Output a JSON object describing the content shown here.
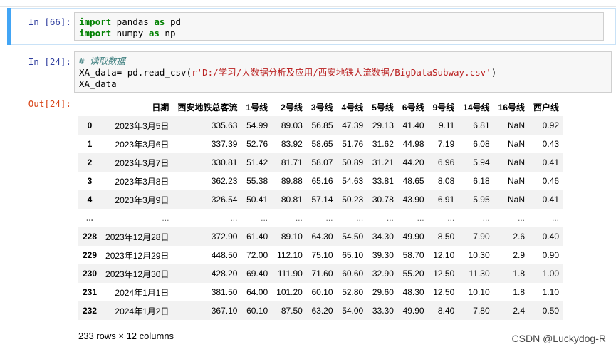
{
  "cell1": {
    "prompt": "In  [66]:",
    "lines": [
      {
        "kw1": "import",
        "mod": " pandas ",
        "kw2": "as",
        "alias": " pd"
      },
      {
        "kw1": "import",
        "mod": " numpy ",
        "kw2": "as",
        "alias": " np"
      }
    ]
  },
  "cell2": {
    "prompt": "In  [24]:",
    "comment": "# 读取数据",
    "line2_prefix": "XA_data= pd.read_csv(",
    "line2_string": "r'D:/学习/大数据分析及应用/西安地铁人流数据/BigDataSubway.csv'",
    "line2_suffix": ")",
    "line3": "XA_data"
  },
  "output": {
    "prompt": "Out[24]:",
    "columns": [
      "",
      "日期",
      "西安地铁总客流",
      "1号线",
      "2号线",
      "3号线",
      "4号线",
      "5号线",
      "6号线",
      "9号线",
      "14号线",
      "16号线",
      "西户线"
    ],
    "rows": [
      [
        "0",
        "2023年3月5日",
        "335.63",
        "54.99",
        "89.03",
        "56.85",
        "47.39",
        "29.13",
        "41.40",
        "9.11",
        "6.81",
        "NaN",
        "0.92"
      ],
      [
        "1",
        "2023年3月6日",
        "337.39",
        "52.76",
        "83.92",
        "58.65",
        "51.76",
        "31.62",
        "44.98",
        "7.19",
        "6.08",
        "NaN",
        "0.43"
      ],
      [
        "2",
        "2023年3月7日",
        "330.81",
        "51.42",
        "81.71",
        "58.07",
        "50.89",
        "31.21",
        "44.20",
        "6.96",
        "5.94",
        "NaN",
        "0.41"
      ],
      [
        "3",
        "2023年3月8日",
        "362.23",
        "55.38",
        "89.88",
        "65.16",
        "54.63",
        "33.81",
        "48.65",
        "8.08",
        "6.18",
        "NaN",
        "0.46"
      ],
      [
        "4",
        "2023年3月9日",
        "326.54",
        "50.41",
        "80.81",
        "57.14",
        "50.23",
        "30.78",
        "43.90",
        "6.91",
        "5.95",
        "NaN",
        "0.41"
      ],
      [
        "...",
        "...",
        "...",
        "...",
        "...",
        "...",
        "...",
        "...",
        "...",
        "...",
        "...",
        "...",
        "..."
      ],
      [
        "228",
        "2023年12月28日",
        "372.90",
        "61.40",
        "89.10",
        "64.30",
        "54.50",
        "34.30",
        "49.90",
        "8.50",
        "7.90",
        "2.6",
        "0.40"
      ],
      [
        "229",
        "2023年12月29日",
        "448.50",
        "72.00",
        "112.10",
        "75.10",
        "65.10",
        "39.30",
        "58.70",
        "12.10",
        "10.30",
        "2.9",
        "0.90"
      ],
      [
        "230",
        "2023年12月30日",
        "428.20",
        "69.40",
        "111.90",
        "71.60",
        "60.60",
        "32.90",
        "55.20",
        "12.50",
        "11.30",
        "1.8",
        "1.00"
      ],
      [
        "231",
        "2024年1月1日",
        "381.50",
        "64.00",
        "101.20",
        "60.10",
        "52.80",
        "29.60",
        "48.30",
        "12.50",
        "10.10",
        "1.8",
        "1.10"
      ],
      [
        "232",
        "2024年1月2日",
        "367.10",
        "60.10",
        "87.50",
        "63.20",
        "54.00",
        "33.30",
        "49.90",
        "8.40",
        "7.80",
        "2.4",
        "0.50"
      ]
    ],
    "shape": "233 rows × 12 columns"
  },
  "watermark": "CSDN @Luckydog-R"
}
